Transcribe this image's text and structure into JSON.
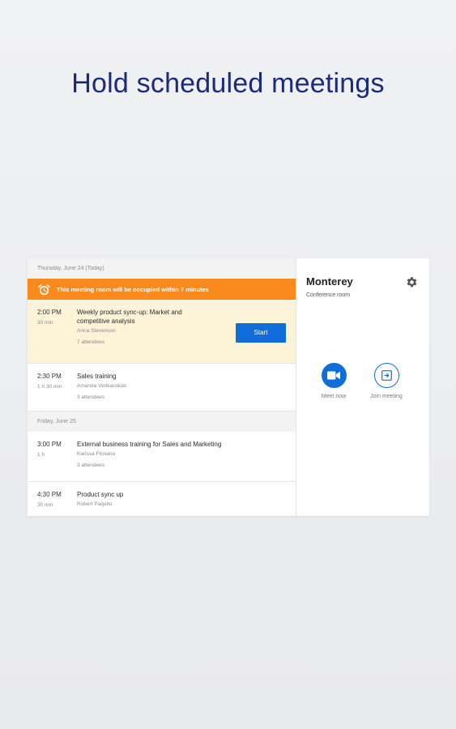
{
  "headline": "Hold scheduled meetings",
  "schedule": {
    "today_header": "Thursday, June 24 (Today)",
    "banner_text": "This meeting room will be occupied within 7 minutes",
    "start_label": "Start",
    "tomorrow_header": "Friday, June 25",
    "meetings": [
      {
        "time": "2:00 PM",
        "duration": "30 min",
        "title": "Weekly product sync-up: Market and competitive analysis",
        "organizer": "Anna Stevenson",
        "attendees": "7 attendees"
      },
      {
        "time": "2:30 PM",
        "duration": "1 h 30 min",
        "title": "Sales training",
        "organizer": "Amanda Verikauskas",
        "attendees": "3 attendees"
      },
      {
        "time": "3:00 PM",
        "duration": "1 h",
        "title": "External business training for Sales and Marketing",
        "organizer": "Karissa Floriana",
        "attendees": "3 attendees"
      },
      {
        "time": "4:30 PM",
        "duration": "30 min",
        "title": "Product sync up",
        "organizer": "Robert Paquito",
        "attendees": ""
      }
    ]
  },
  "room": {
    "name": "Monterey",
    "type": "Conference room",
    "meet_now_label": "Meet now",
    "join_label": "Join meeting"
  },
  "colors": {
    "accent": "#0f6ed9",
    "banner": "#f98a1d",
    "active_row": "#fdf3d9",
    "headline": "#1b2a7a"
  },
  "icons": [
    "alarm-icon",
    "gear-icon",
    "video-camera-icon",
    "join-meeting-icon"
  ]
}
